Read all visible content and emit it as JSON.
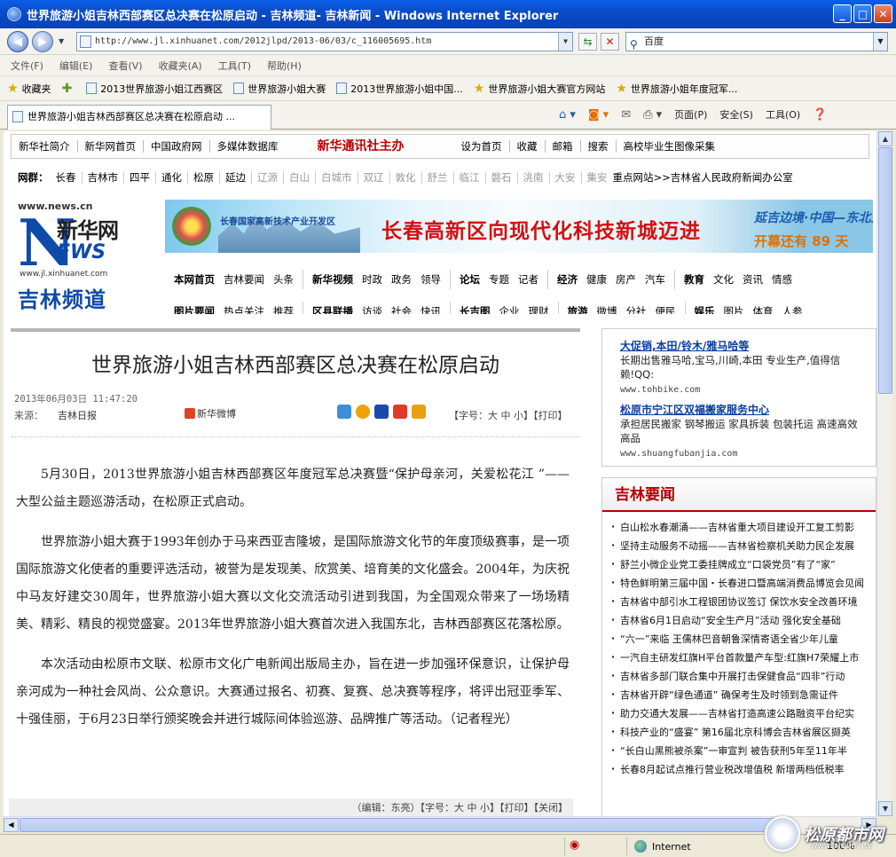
{
  "window": {
    "title": "世界旅游小姐吉林西部赛区总决赛在松原启动 - 吉林频道- 吉林新闻 - Windows Internet Explorer"
  },
  "address_bar": {
    "url": "http://www.jl.xinhuanet.com/2012jlpd/2013-06/03/c_116005695.htm",
    "search_placeholder": "百度"
  },
  "menu": [
    "文件(F)",
    "编辑(E)",
    "查看(V)",
    "收藏夹(A)",
    "工具(T)",
    "帮助(H)"
  ],
  "favorites_bar": {
    "label": "收藏夹",
    "items": [
      "2013世界旅游小姐江西赛区",
      "世界旅游小姐大赛",
      "2013世界旅游小姐中国...",
      "世界旅游小姐大赛官方网站",
      "世界旅游小姐年度冠军..."
    ]
  },
  "tab": {
    "label": "世界旅游小姐吉林西部赛区总决赛在松原启动 ..."
  },
  "command_bar": {
    "page": "页面(P)",
    "safety": "安全(S)",
    "tools": "工具(O)"
  },
  "status_bar": {
    "zone": "Internet",
    "zoom": "100%"
  },
  "watermark": {
    "text": "松原都市网",
    "sub": "www.sy1987.tv"
  },
  "page": {
    "top_nav": {
      "left": [
        "新华社简介",
        "新华网首页",
        "中国政府网",
        "多媒体数据库"
      ],
      "center": "新华通讯社主办",
      "right": [
        "设为首页",
        "收藏",
        "邮箱",
        "搜索",
        "高校毕业生图像采集"
      ]
    },
    "wangqun": {
      "label": "网群：",
      "cities": [
        "长春",
        "吉林市",
        "四平",
        "通化",
        "松原",
        "延边"
      ],
      "cities_gray": [
        "辽源",
        "白山",
        "白城市",
        "双辽",
        "敦化",
        "舒兰",
        "临江",
        "磐石",
        "洮南",
        "大安",
        "集安"
      ],
      "tail": "重点网站>>吉林省人民政府新闻办公室"
    },
    "logo": {
      "url_top": "www.news.cn",
      "brand": "新华网",
      "news": "EWS",
      "url_bottom": "www.jl.xinhuanet.com",
      "channel": "吉林频道"
    },
    "banner": {
      "small": "长春国家高新技术产业开发区",
      "headline": "长春高新区向现代化科技新城迈进",
      "right1": "延吉边境·中国—东北亚博",
      "right2": "开幕还有  89  天"
    },
    "channel_nav": {
      "row1": [
        [
          "本网首页",
          "吉林要闻",
          "头条"
        ],
        [
          "新华视频",
          "时政",
          "政务",
          "领导"
        ],
        [
          "论坛",
          "专题",
          "记者"
        ],
        [
          "经济",
          "健康",
          "房产",
          "汽车"
        ],
        [
          "教育",
          "文化",
          "资讯",
          "情感"
        ]
      ],
      "row2": [
        [
          "图片要闻",
          "热点关注",
          "推荐"
        ],
        [
          "区县联播",
          "访谈",
          "社会",
          "快讯"
        ],
        [
          "长吉图",
          "企业",
          "理财"
        ],
        [
          "旅游",
          "微博",
          "分社",
          "便民"
        ],
        [
          "娱乐",
          "图片",
          "体育",
          "人参"
        ]
      ]
    },
    "article": {
      "title": "世界旅游小姐吉林西部赛区总决赛在松原启动",
      "datetime": "2013年06月03日 11:47:20",
      "source_label": "来源：",
      "source": "吉林日报",
      "weibo": "新华微博",
      "font_ctrl": "【字号：大 中 小】【打印】",
      "paragraphs": [
        "5月30日，2013世界旅游小姐吉林西部赛区年度冠军总决赛暨“保护母亲河，关爱松花江 ”——大型公益主题巡游活动，在松原正式启动。",
        "世界旅游小姐大赛于1993年创办于马来西亚吉隆坡，是国际旅游文化节的年度顶级赛事，是一项国际旅游文化使者的重要评选活动，被誉为是发现美、欣赏美、培育美的文化盛会。2004年，为庆祝中马友好建交30周年，世界旅游小姐大赛以文化交流活动引进到我国，为全国观众带来了一场场精美、精彩、精良的视觉盛宴。2013年世界旅游小姐大赛首次进入我国东北，吉林西部赛区花落松原。",
        "本次活动由松原市文联、松原市文化广电新闻出版局主办，旨在进一步加强环保意识，让保护母亲河成为一种社会风尚、公众意识。大赛通过报名、初赛、复赛、总决赛等程序，将评出冠亚季军、十强佳丽，于6月23日举行颁奖晚会并进行城际间体验巡游、品牌推广等活动。（记者程光）"
      ],
      "footer": "（编辑：东亮）【字号：大 中 小】【打印】【关闭】"
    },
    "ad": {
      "h1": "大促销,本田/铃木/雅马哈等",
      "t1": "长期出售雅马哈,宝马,川崎,本田 专业生产,值得信赖!QQ:",
      "u1": "www.tohbike.com",
      "h2": "松原市宁江区双福搬家服务中心",
      "t2": "承担居民搬家 钢琴搬运 家具拆装 包装托运 高速高效 高品",
      "u2": "www.shuangfubanjia.com"
    },
    "jilin_news": {
      "heading": "吉林要闻",
      "items": [
        "白山松水春潮涌——吉林省重大项目建设开工复工剪影",
        "坚持主动服务不动摇——吉林省检察机关助力民企发展",
        "舒兰小微企业党工委挂牌成立“口袋党员”有了“家”",
        "特色鲜明第三届中国・长春进口暨高端消费品博览会见闻",
        "吉林省中部引水工程银团协议签订 保饮水安全改善环境",
        "吉林省6月1日启动“安全生产月”活动 强化安全基础",
        "“六一”来临  王儒林巴音朝鲁深情寄语全省少年儿童",
        "一汽自主研发红旗H平台首款量产车型:红旗H7荣耀上市",
        "吉林省多部门联合集中开展打击保健食品“四非”行动",
        "吉林省开辟“绿色通道”  确保考生及时领到急需证件",
        "助力交通大发展——吉林省打造高速公路融资平台纪实",
        "科技产业的“盛宴”  第16届北京科博会吉林省展区撷英",
        "“长白山黑熊被杀案”一审宣判 被告获刑5年至11年半",
        "长春8月起试点推行营业税改增值税  新增两档低税率"
      ]
    }
  }
}
